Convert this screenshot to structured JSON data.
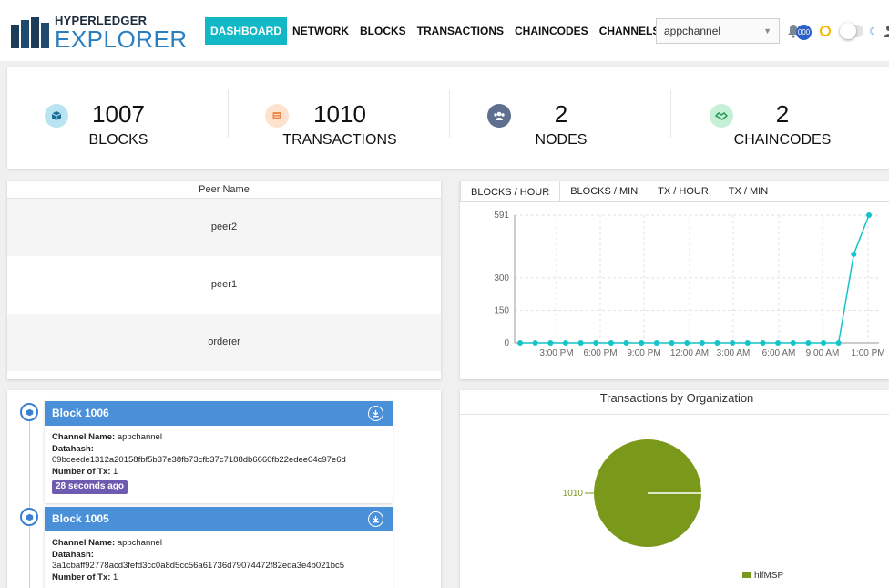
{
  "header": {
    "logo_top": "HYPERLEDGER",
    "logo_bottom": "EXPLORER",
    "nav": [
      {
        "label": "DASHBOARD",
        "active": true
      },
      {
        "label": "NETWORK",
        "active": false
      },
      {
        "label": "BLOCKS",
        "active": false
      },
      {
        "label": "TRANSACTIONS",
        "active": false
      },
      {
        "label": "CHAINCODES",
        "active": false
      },
      {
        "label": "CHANNELS",
        "active": false
      }
    ],
    "channel_select": "appchannel",
    "notification_badge": "000",
    "accent_color": "#13b8c7"
  },
  "stats": [
    {
      "value": "1007",
      "label": "BLOCKS",
      "icon": "cube-icon",
      "bg": "#b9e3f0",
      "fg": "#1a6e9a"
    },
    {
      "value": "1010",
      "label": "TRANSACTIONS",
      "icon": "receipt-icon",
      "bg": "#fde3cf",
      "fg": "#f08a4b"
    },
    {
      "value": "2",
      "label": "NODES",
      "icon": "users-icon",
      "bg": "#5e6f8f",
      "fg": "#ffffff"
    },
    {
      "value": "2",
      "label": "CHAINCODES",
      "icon": "handshake-icon",
      "bg": "#c6f0d6",
      "fg": "#1e9b56"
    }
  ],
  "peers": {
    "header": "Peer Name",
    "rows": [
      "peer2",
      "peer1",
      "orderer"
    ]
  },
  "chart_tabs": [
    {
      "label": "BLOCKS / HOUR",
      "active": true
    },
    {
      "label": "BLOCKS / MIN",
      "active": false
    },
    {
      "label": "TX / HOUR",
      "active": false
    },
    {
      "label": "TX / MIN",
      "active": false
    }
  ],
  "chart_data": [
    {
      "type": "line",
      "title": "",
      "xlabel": "",
      "ylabel": "",
      "ylim": [
        0,
        591
      ],
      "yticks": [
        "0",
        "150",
        "300",
        "591"
      ],
      "xticks": [
        "3:00 PM",
        "6:00 PM",
        "9:00 PM",
        "12:00 AM",
        "3:00 AM",
        "6:00 AM",
        "9:00 AM",
        "1:00 PM"
      ],
      "values": [
        0,
        0,
        0,
        0,
        0,
        0,
        0,
        0,
        0,
        0,
        0,
        0,
        0,
        0,
        0,
        0,
        0,
        0,
        0,
        0,
        0,
        0,
        410,
        591
      ],
      "color": "#13c4c9",
      "grid": true
    },
    {
      "type": "pie",
      "title": "Transactions by Organization",
      "slices": [
        {
          "name": "hlfMSP",
          "value": 1010,
          "label": "1010",
          "color": "#7a991a"
        }
      ],
      "legend": "bottom-right"
    }
  ],
  "blocks": [
    {
      "title": "Block 1006",
      "channel_label": "Channel Name:",
      "channel": "appchannel",
      "datahash_label": "Datahash:",
      "datahash": "09bceede1312a20158fbf5b37e38fb73cfb37c7188db6660fb22edee04c97e6d",
      "ntx_label": "Number of Tx:",
      "ntx": "1",
      "time": "28 seconds ago"
    },
    {
      "title": "Block 1005",
      "channel_label": "Channel Name:",
      "channel": "appchannel",
      "datahash_label": "Datahash:",
      "datahash": "3a1cbaff92778acd3fefd3cc0a8d5cc56a61736d79074472f82eda3e4b021bc5",
      "ntx_label": "Number of Tx:",
      "ntx": "1",
      "time": ""
    }
  ]
}
